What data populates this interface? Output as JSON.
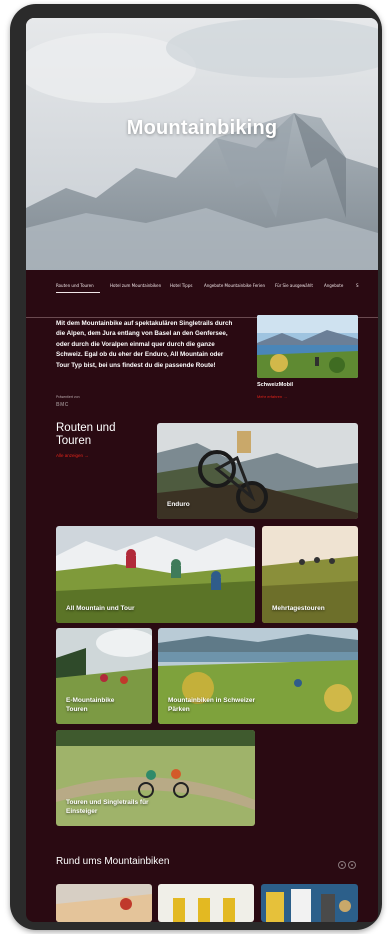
{
  "hero": {
    "title": "Mountainbiking"
  },
  "tabs": [
    "Routen und Touren",
    "Hotel zum Mountainbiken",
    "Hotel Tipps",
    "Angebote Mountainbike Ferien",
    "Für Sie ausgewählt",
    "Angebote",
    "S"
  ],
  "intro": {
    "text": "Mit dem Mountainbike auf spektakulären Singletrails durch die Alpen, dem Jura entlang von Basel an den Genfersee, oder durch die Voralpen einmal quer durch die ganze Schweiz. Egal ob du eher der Enduro, All Mountain oder Tour Typ bist, bei uns findest du die passende Route!",
    "presented_by": "Präsentiert von",
    "sponsor": "BMC"
  },
  "promo": {
    "title": "SchweizMobil",
    "link": "Mehr erfahren →"
  },
  "routes_section": {
    "title_line1": "Routen und",
    "title_line2": "Touren",
    "all_link": "Alle anzeigen →"
  },
  "cards": {
    "enduro": "Enduro",
    "all_mountain": "All Mountain und Tour",
    "multi_day": "Mehrtagestouren",
    "e_mtb_line1": "E-Mountainbike",
    "e_mtb_line2": "Touren",
    "parks_line1": "Mountainbiken in Schweizer",
    "parks_line2": "Pärken",
    "beginners_line1": "Touren und Singletrails für",
    "beginners_line2": "Einsteiger"
  },
  "bottom_section": {
    "title": "Rund ums Mountainbiken"
  },
  "colors": {
    "background": "#2a0a12",
    "accent": "#e2231a",
    "frame": "#2b2b2b"
  }
}
